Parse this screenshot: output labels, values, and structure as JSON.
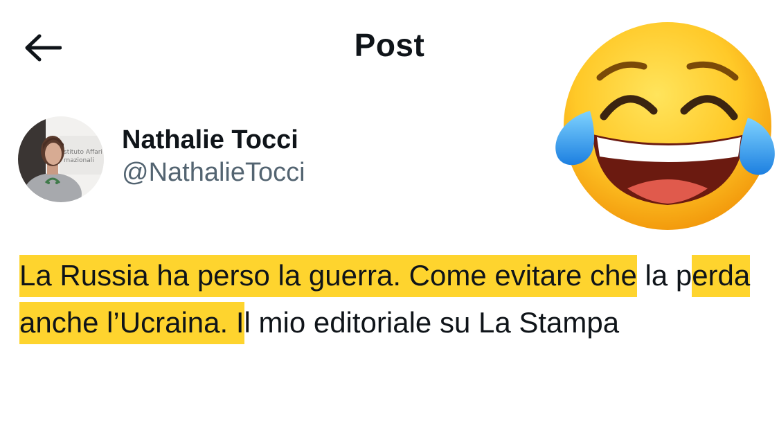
{
  "header": {
    "back_icon": "arrow-left-icon",
    "title": "Post"
  },
  "author": {
    "display_name": "Nathalie Tocci",
    "handle": "@NathalieTocci",
    "avatar_sign_text": "stituto Affari\nrnazionali"
  },
  "tweet": {
    "highlight_1": "La Russia ha perso la guerra. Come evitare che",
    "after_1": " la ",
    "plain_p": "p",
    "highlight_2": "erda anche l’Ucraina. I",
    "rest": "l mio editoriale su La Stampa"
  },
  "overlay": {
    "emoji": "face-with-tears-of-joy-icon"
  },
  "colors": {
    "highlight": "#fed42e",
    "text": "#0f1419",
    "secondary_text": "#536471"
  }
}
